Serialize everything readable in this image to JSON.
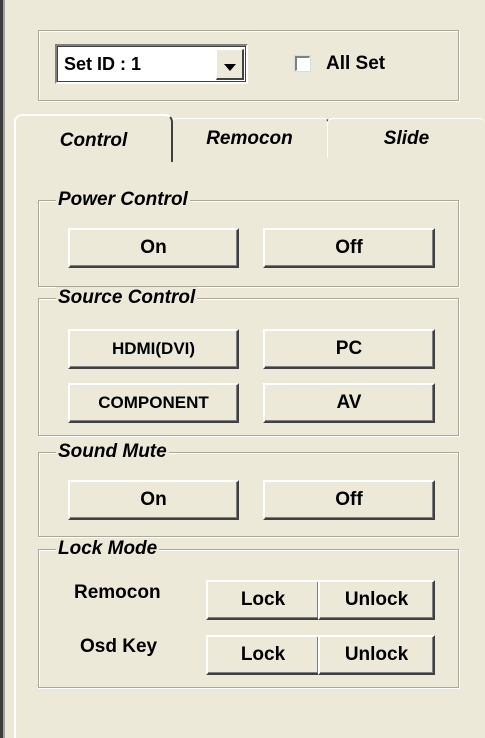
{
  "set_id": {
    "label": "Set ID : ",
    "value": "1"
  },
  "all_set": {
    "label": "All Set",
    "checked": false
  },
  "tabs": [
    {
      "label": "Control",
      "active": true
    },
    {
      "label": "Remocon",
      "active": false
    },
    {
      "label": "Slide",
      "active": false
    }
  ],
  "power_control": {
    "title": "Power Control",
    "on": "On",
    "off": "Off"
  },
  "source_control": {
    "title": "Source Control",
    "hdmi": "HDMI(DVI)",
    "pc": "PC",
    "component": "COMPONENT",
    "av": "AV"
  },
  "sound_mute": {
    "title": "Sound Mute",
    "on": "On",
    "off": "Off"
  },
  "lock_mode": {
    "title": "Lock Mode",
    "remocon": {
      "label": "Remocon",
      "lock": "Lock",
      "unlock": "Unlock"
    },
    "osd_key": {
      "label": "Osd Key",
      "lock": "Lock",
      "unlock": "Unlock"
    }
  }
}
